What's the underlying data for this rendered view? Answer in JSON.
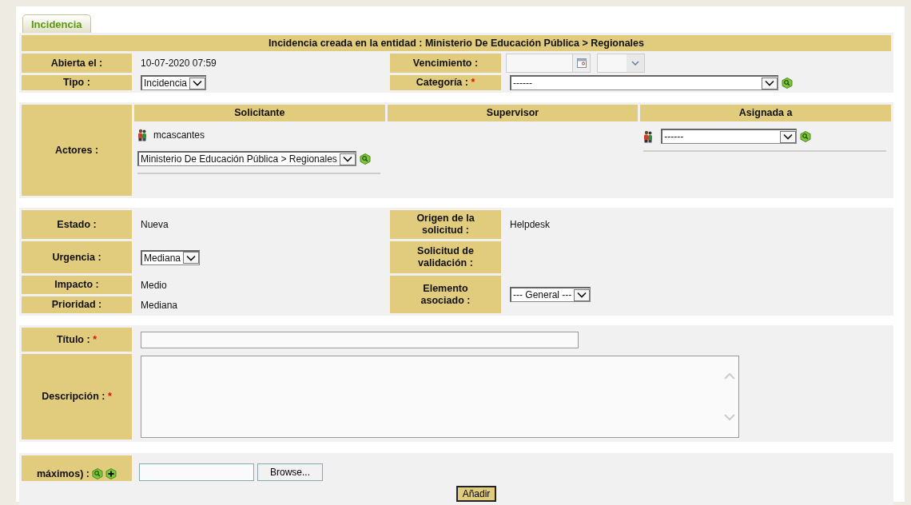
{
  "tab": {
    "label": "Incidencia",
    "selected": true
  },
  "header": "Incidencia creada en la entidad : Ministerio De Educación Pública > Regionales",
  "general": [
    {
      "label": "Abierta el :",
      "kind": "text",
      "value": "10-07-2020 07:59"
    },
    {
      "label": "Vencimiento :",
      "kind": "date"
    },
    {
      "label": "Tipo :",
      "kind": "select",
      "value": "Incidencia"
    },
    {
      "label": "Categoría :",
      "mark": "*",
      "kind": "select",
      "value": "------",
      "wide": true,
      "search": true
    }
  ],
  "actors": {
    "label": "Actores :",
    "columns": [
      {
        "title": "Solicitante",
        "user": "mcascantes",
        "select": "Ministerio De Educación Pública > Regionales"
      },
      {
        "title": "Supervisor"
      },
      {
        "title": "Asignada a",
        "select": "------",
        "user_icon": true
      }
    ]
  },
  "status_left": [
    {
      "label": "Estado :",
      "kind": "text",
      "value": "Nueva"
    },
    {
      "label": "Urgencia :",
      "kind": "select",
      "value": "Mediana"
    },
    {
      "label": "Impacto :",
      "kind": "text",
      "value": "Medio"
    },
    {
      "label": "Prioridad :",
      "kind": "text",
      "value": "Mediana"
    }
  ],
  "status_right": [
    {
      "label": "Origen de la solicitud :",
      "kind": "text",
      "value": "Helpdesk"
    },
    {
      "label": "Solicitud de validación :",
      "kind": "none"
    },
    {
      "label": "Elemento asociado :",
      "kind": "select",
      "value": "--- General ---"
    }
  ],
  "content": [
    {
      "label": "Título :",
      "mark": "*",
      "kind": "input"
    },
    {
      "label": "Descripción :",
      "mark": "*",
      "kind": "textarea"
    }
  ],
  "file": {
    "label": "máximos) :",
    "button": "Browse..."
  },
  "submit": "Añadir"
}
